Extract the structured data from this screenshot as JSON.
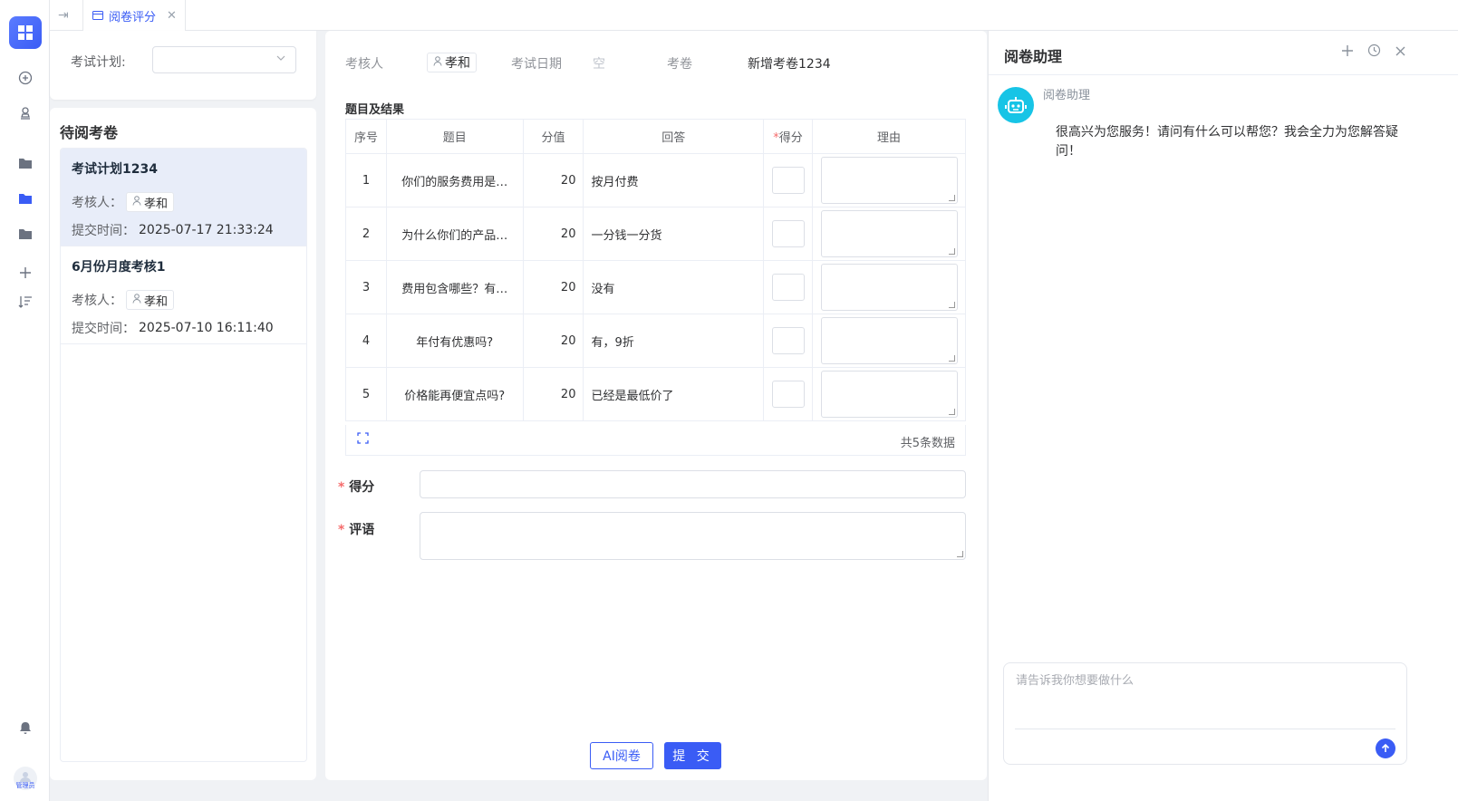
{
  "tabs": [
    {
      "label": "阅卷评分"
    }
  ],
  "filter": {
    "label": "考试计划:",
    "value": ""
  },
  "pending": {
    "title": "待阅考卷",
    "items": [
      {
        "title": "考试计划1234",
        "reviewer_label": "考核人：",
        "reviewer": "孝和",
        "time_label": "提交时间：",
        "time": "2025-07-17 21:33:24"
      },
      {
        "title": "6月份月度考核1",
        "reviewer_label": "考核人：",
        "reviewer": "孝和",
        "time_label": "提交时间：",
        "time": "2025-07-10 16:11:40"
      }
    ]
  },
  "detail": {
    "reviewer_label": "考核人",
    "reviewer": "孝和",
    "date_label": "考试日期",
    "date_value": "空",
    "paper_label": "考卷",
    "paper_value": "新增考卷1234",
    "section_title": "题目及结果",
    "columns": [
      "序号",
      "题目",
      "分值",
      "回答",
      "得分",
      "理由"
    ],
    "rows": [
      {
        "no": "1",
        "question": "你们的服务费用是…",
        "points": "20",
        "answer": "按月付费"
      },
      {
        "no": "2",
        "question": "为什么你们的产品…",
        "points": "20",
        "answer": "一分钱一分货"
      },
      {
        "no": "3",
        "question": "费用包含哪些？有…",
        "points": "20",
        "answer": "没有"
      },
      {
        "no": "4",
        "question": "年付有优惠吗?",
        "points": "20",
        "answer": "有，9折"
      },
      {
        "no": "5",
        "question": "价格能再便宜点吗?",
        "points": "20",
        "answer": "已经是最低价了"
      }
    ],
    "total_text": "共5条数据",
    "score_label": "得分",
    "comment_label": "评语",
    "ai_button": "AI阅卷",
    "submit_button": "提 交"
  },
  "assistant": {
    "title": "阅卷助理",
    "bot_name": "阅卷助理",
    "message": "很高兴为您服务！请问有什么可以帮您？我会全力为您解答疑问！",
    "input_placeholder": "请告诉我你想要做什么"
  },
  "user": {
    "role": "管理员"
  },
  "colors": {
    "primary": "#3a5cf5",
    "bot": "#17c4e6",
    "required": "#f56c6c"
  }
}
